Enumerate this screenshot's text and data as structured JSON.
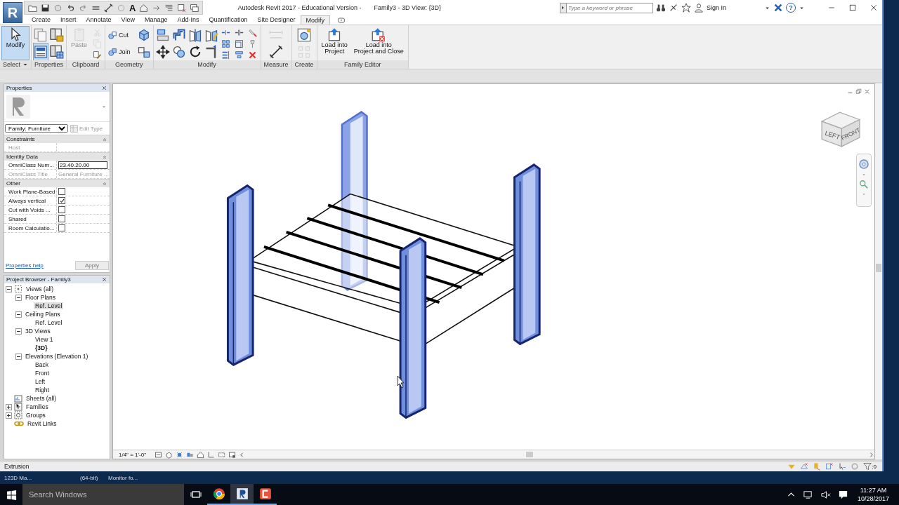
{
  "app_menu": {
    "label": "R"
  },
  "quick_access": {
    "text_tool": "A"
  },
  "window": {
    "title_app": "Autodesk Revit 2017 - Educational Version -",
    "title_view": "Family3 - 3D View: {3D}"
  },
  "search": {
    "placeholder": "Type a keyword or phrase"
  },
  "sign_in": "Sign In",
  "help": "?",
  "tabs": [
    {
      "label": "Create",
      "selected": false
    },
    {
      "label": "Insert",
      "selected": false
    },
    {
      "label": "Annotate",
      "selected": false
    },
    {
      "label": "View",
      "selected": false
    },
    {
      "label": "Manage",
      "selected": false
    },
    {
      "label": "Add-Ins",
      "selected": false
    },
    {
      "label": "Quantification",
      "selected": false
    },
    {
      "label": "Site Designer",
      "selected": false
    },
    {
      "label": "Modify",
      "selected": true
    }
  ],
  "ribbon": [
    {
      "label": "Select",
      "dropdown": true,
      "tools": [
        {
          "kind": "large",
          "lines": [
            "Modify"
          ],
          "selected": true,
          "disabled": false
        }
      ]
    },
    {
      "label": "Properties",
      "tools": [
        {
          "kind": "medium",
          "selected": false,
          "disabled": false
        },
        {
          "kind": "medium",
          "selected": true,
          "disabled": false
        },
        {
          "kind": "medium",
          "selected": false,
          "disabled": false
        },
        {
          "kind": "medium",
          "selected": false,
          "disabled": false
        }
      ]
    },
    {
      "label": "Clipboard",
      "tools": [
        {
          "kind": "large",
          "lines": [
            "Paste"
          ],
          "selected": false,
          "disabled": true
        },
        {
          "kind": "small",
          "selected": false,
          "disabled": true
        },
        {
          "kind": "small",
          "selected": false,
          "disabled": true
        },
        {
          "kind": "small",
          "selected": false,
          "disabled": false
        }
      ]
    },
    {
      "label": "Geometry",
      "tools": [
        {
          "kind": "row",
          "label": "Cut",
          "selected": false,
          "disabled": false
        },
        {
          "kind": "row",
          "label": "Join",
          "selected": false,
          "disabled": false
        },
        {
          "kind": "medium",
          "selected": false,
          "disabled": false
        },
        {
          "kind": "medium",
          "selected": false,
          "disabled": false
        }
      ]
    },
    {
      "label": "Modify",
      "tools": [
        {
          "kind": "medium",
          "selected": false,
          "disabled": false
        },
        {
          "kind": "medium",
          "selected": false,
          "disabled": false
        },
        {
          "kind": "medium",
          "selected": false,
          "disabled": false
        },
        {
          "kind": "medium",
          "selected": false,
          "disabled": false
        },
        {
          "kind": "medium",
          "selected": false,
          "disabled": false
        },
        {
          "kind": "medium",
          "selected": false,
          "disabled": false
        },
        {
          "kind": "medium",
          "selected": false,
          "disabled": false
        },
        {
          "kind": "medium",
          "selected": false,
          "disabled": false
        },
        {
          "kind": "small",
          "selected": false,
          "disabled": false
        },
        {
          "kind": "small",
          "selected": false,
          "disabled": false
        },
        {
          "kind": "small",
          "selected": false,
          "disabled": false
        },
        {
          "kind": "small",
          "selected": false,
          "disabled": false
        },
        {
          "kind": "small",
          "selected": false,
          "disabled": false
        },
        {
          "kind": "small",
          "selected": false,
          "disabled": false
        },
        {
          "kind": "small",
          "selected": false,
          "disabled": false
        },
        {
          "kind": "small",
          "selected": false,
          "disabled": false
        },
        {
          "kind": "small",
          "selected": false,
          "disabled": false
        }
      ]
    },
    {
      "label": "Measure",
      "tools": [
        {
          "kind": "medium",
          "selected": false,
          "disabled": true
        },
        {
          "kind": "medium",
          "selected": false,
          "disabled": false
        }
      ]
    },
    {
      "label": "Create",
      "tools": [
        {
          "kind": "medium",
          "selected": false,
          "disabled": false
        },
        {
          "kind": "medium",
          "selected": false,
          "disabled": true
        }
      ]
    },
    {
      "label": "Family Editor",
      "tools": [
        {
          "kind": "large",
          "lines": [
            "Load into",
            "Project"
          ],
          "selected": false,
          "disabled": false
        },
        {
          "kind": "large",
          "lines": [
            "Load into",
            "Project and Close"
          ],
          "selected": false,
          "disabled": false
        }
      ]
    }
  ],
  "properties": {
    "title": "Properties",
    "type_selector": "Family: Furniture",
    "edit_type": "Edit Type",
    "groups": [
      {
        "name": "Constraints",
        "rows": [
          {
            "label": "Host",
            "kind": "text",
            "disabled": true
          }
        ]
      },
      {
        "name": "Identity Data",
        "rows": [
          {
            "label": "OmniClass Num...",
            "kind": "field",
            "value": "23.40.20.00",
            "disabled": false
          },
          {
            "label": "OmniClass Title",
            "kind": "text",
            "value": "General Furniture ...",
            "disabled": true
          }
        ]
      },
      {
        "name": "Other",
        "rows": [
          {
            "label": "Work Plane-Based",
            "kind": "checkbox",
            "checked": false,
            "disabled": false
          },
          {
            "label": "Always vertical",
            "kind": "checkbox",
            "checked": true,
            "disabled": false
          },
          {
            "label": "Cut with Voids ...",
            "kind": "checkbox",
            "checked": false,
            "disabled": false
          },
          {
            "label": "Shared",
            "kind": "checkbox",
            "checked": false,
            "disabled": false
          },
          {
            "label": "Room Calculatio...",
            "kind": "checkbox",
            "checked": false,
            "disabled": false
          }
        ]
      }
    ],
    "help_link": "Properties help",
    "apply": {
      "label": "Apply",
      "disabled": true
    }
  },
  "project_browser": {
    "title": "Project Browser - Family3",
    "tree": [
      {
        "label": "Views (all)",
        "kind": "views",
        "expanded": true,
        "selected": false,
        "bold": false,
        "children": [
          {
            "label": "Floor Plans",
            "expanded": true,
            "selected": false,
            "bold": false,
            "children": [
              {
                "label": "Ref. Level",
                "selected": true,
                "bold": false
              }
            ]
          },
          {
            "label": "Ceiling Plans",
            "expanded": true,
            "selected": false,
            "bold": false,
            "children": [
              {
                "label": "Ref. Level",
                "selected": false,
                "bold": false
              }
            ]
          },
          {
            "label": "3D Views",
            "expanded": true,
            "selected": false,
            "bold": false,
            "children": [
              {
                "label": "View 1",
                "selected": false,
                "bold": false
              },
              {
                "label": "{3D}",
                "selected": false,
                "bold": true
              }
            ]
          },
          {
            "label": "Elevations (Elevation 1)",
            "expanded": true,
            "selected": false,
            "bold": false,
            "children": [
              {
                "label": "Back",
                "selected": false,
                "bold": false
              },
              {
                "label": "Front",
                "selected": false,
                "bold": false
              },
              {
                "label": "Left",
                "selected": false,
                "bold": false
              },
              {
                "label": "Right",
                "selected": false,
                "bold": false
              }
            ]
          }
        ]
      },
      {
        "label": "Sheets (all)",
        "kind": "sheets",
        "selected": false,
        "bold": false
      },
      {
        "label": "Families",
        "kind": "families",
        "expanded": false,
        "selected": false,
        "bold": false
      },
      {
        "label": "Groups",
        "kind": "groups",
        "expanded": false,
        "selected": false,
        "bold": false
      },
      {
        "label": "Revit Links",
        "kind": "links",
        "selected": false,
        "bold": false
      }
    ]
  },
  "view_cube": {
    "faces": [
      "LEFT",
      "FRONT"
    ]
  },
  "view_bar": {
    "scale": "1/4\" = 1'-0\""
  },
  "status_bar": {
    "text": "Extrusion",
    "filter_count": ":0"
  },
  "desktop_icons": [
    "123D Ma...",
    "(64-bit)",
    "Monitor fo..."
  ],
  "taskbar": {
    "search_placeholder": "Search Windows",
    "apps": [
      {
        "kind": "chrome",
        "selected": false
      },
      {
        "kind": "revit",
        "selected": true
      },
      {
        "kind": "camtasia",
        "selected": false
      }
    ],
    "time": "11:27 AM",
    "date": "10/28/2017"
  }
}
